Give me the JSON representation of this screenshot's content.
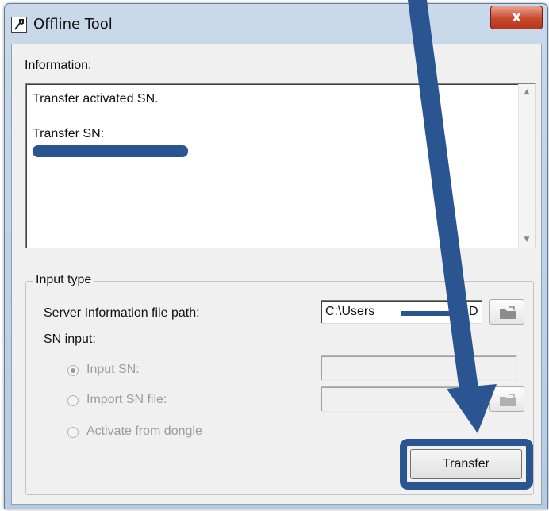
{
  "window": {
    "title": "Offline Tool",
    "close_glyph": "x"
  },
  "information": {
    "label": "Information:",
    "lines": [
      "Transfer activated SN.",
      "Transfer SN:"
    ]
  },
  "input_type": {
    "legend": "Input type",
    "server_path_label": "Server Information file path:",
    "server_path_value": "C:\\Users",
    "server_path_suffix": "D",
    "sn_input_label": "SN input:",
    "options": [
      {
        "label": "Input SN:",
        "checked": true
      },
      {
        "label": "Import SN file:",
        "checked": false
      },
      {
        "label": "Activate from dongle",
        "checked": false
      }
    ]
  },
  "buttons": {
    "transfer": "Transfer"
  },
  "icons": {
    "app": "wrench-icon",
    "browse": "folder-icon",
    "close": "close-icon"
  },
  "colors": {
    "annotation": "#2a5590",
    "close_button": "#c74a2e"
  }
}
